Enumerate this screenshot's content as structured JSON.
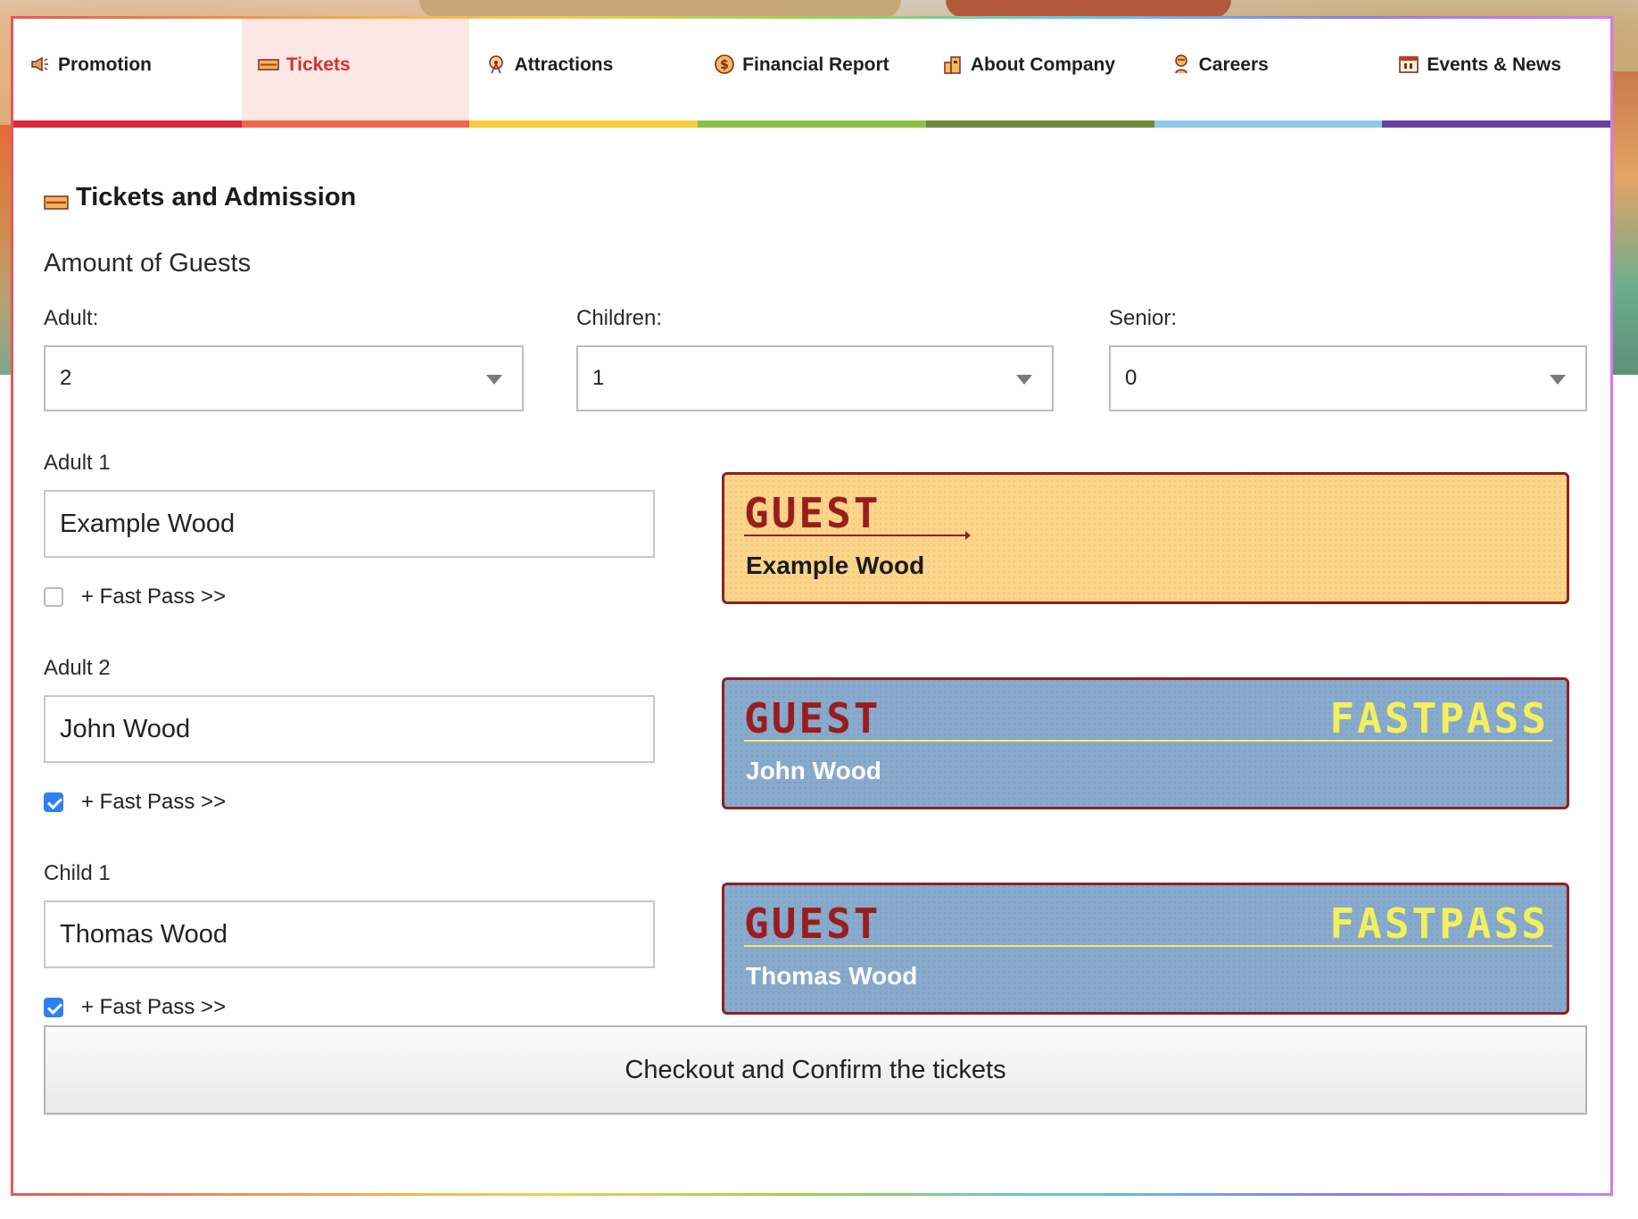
{
  "nav": {
    "items": [
      {
        "label": "Promotion",
        "icon": "megaphone-icon",
        "color": "#d9293f",
        "active": false
      },
      {
        "label": "Tickets",
        "icon": "ticket-icon",
        "color": "#f0684d",
        "active": true
      },
      {
        "label": "Attractions",
        "icon": "ferris-wheel-icon",
        "color": "#f6cf3b",
        "active": false
      },
      {
        "label": "Financial Report",
        "icon": "dollar-coin-icon",
        "color": "#8cc24a",
        "active": false
      },
      {
        "label": "About Company",
        "icon": "building-icon",
        "color": "#6e8b3b",
        "active": false
      },
      {
        "label": "Careers",
        "icon": "person-icon",
        "color": "#8fcbe8",
        "active": false
      },
      {
        "label": "Events & News",
        "icon": "calendar-icon",
        "color": "#6b3f9e",
        "active": false
      }
    ]
  },
  "page": {
    "title": "Tickets and Admission",
    "title_icon": "ticket-icon",
    "section_title": "Amount of Guests"
  },
  "guest_counts": {
    "adult": {
      "label": "Adult:",
      "value": "2"
    },
    "children": {
      "label": "Children:",
      "value": "1"
    },
    "senior": {
      "label": "Senior:",
      "value": "0"
    }
  },
  "guests": [
    {
      "label": "Adult 1",
      "name": "Example Wood",
      "fast_pass": false,
      "fast_pass_label": "+ Fast Pass >>"
    },
    {
      "label": "Adult 2",
      "name": "John Wood",
      "fast_pass": true,
      "fast_pass_label": "+ Fast Pass >>"
    },
    {
      "label": "Child 1",
      "name": "Thomas Wood",
      "fast_pass": true,
      "fast_pass_label": "+ Fast Pass >>"
    }
  ],
  "tickets": [
    {
      "header": "GUEST",
      "badge": "",
      "holder": "Example Wood",
      "type": "basic"
    },
    {
      "header": "GUEST",
      "badge": "FASTPASS",
      "holder": "John Wood",
      "type": "fast"
    },
    {
      "header": "GUEST",
      "badge": "FASTPASS",
      "holder": "Thomas Wood",
      "type": "fast"
    }
  ],
  "checkout": {
    "label": "Checkout and Confirm the tickets"
  },
  "colors": {
    "accent": "#d2322b",
    "ticket_basic": "#fcd48a",
    "ticket_fast": "#87aacd",
    "ticket_border": "#8d2222",
    "fastpass_text": "#f4f05c",
    "checkbox_checked": "#2f7ff2"
  }
}
